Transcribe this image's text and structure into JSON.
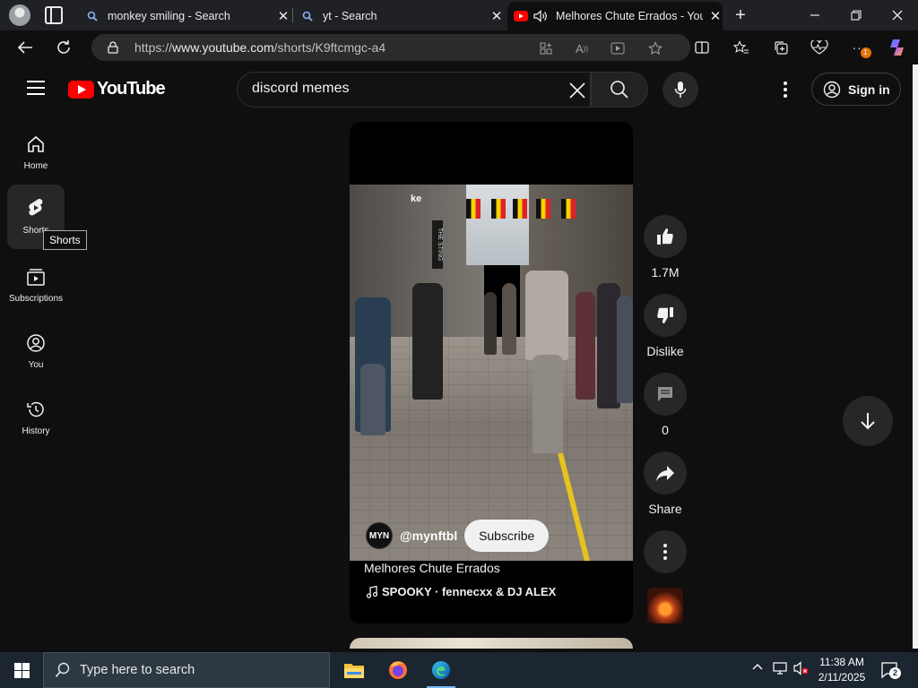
{
  "browser": {
    "tabs": [
      {
        "title": "monkey smiling - Search",
        "favicon": "bing-search-icon"
      },
      {
        "title": "yt - Search",
        "favicon": "bing-search-icon"
      },
      {
        "title": "Melhores Chute Errados - YouTube",
        "favicon": "youtube-icon",
        "audio": true,
        "active": true
      }
    ],
    "url_prefix": "https://",
    "url_host": "www.youtube.com",
    "url_path": "/shorts/K9ftcmgc-a4",
    "extension_badge": "1"
  },
  "youtube": {
    "logo_text": "YouTube",
    "search_value": "discord memes",
    "search_placeholder": "Search",
    "signin_label": "Sign in",
    "sidenav": [
      {
        "label": "Home",
        "icon": "home-icon"
      },
      {
        "label": "Shorts",
        "icon": "shorts-icon",
        "active": true
      },
      {
        "label": "Subscriptions",
        "icon": "subscriptions-icon"
      },
      {
        "label": "You",
        "icon": "you-icon"
      },
      {
        "label": "History",
        "icon": "history-icon"
      }
    ],
    "tooltip": "Shorts",
    "short": {
      "scene_tag": "ke",
      "sign_text": "THE STING",
      "channel_avatar": "MYN",
      "channel_handle": "@mynftbl",
      "subscribe_label": "Subscribe",
      "title": "Melhores Chute Errados",
      "music": "SPOOKY · fennecxx & DJ ALEX"
    },
    "actions": {
      "like_count": "1.7M",
      "dislike_label": "Dislike",
      "comment_count": "0",
      "share_label": "Share"
    }
  },
  "taskbar": {
    "search_placeholder": "Type here to search",
    "time": "11:38 AM",
    "date": "2/11/2025",
    "notification_count": "2"
  },
  "colors": {
    "youtube_red": "#ff0000",
    "page_bg": "#0f0f0f",
    "chip_bg": "#272727"
  }
}
